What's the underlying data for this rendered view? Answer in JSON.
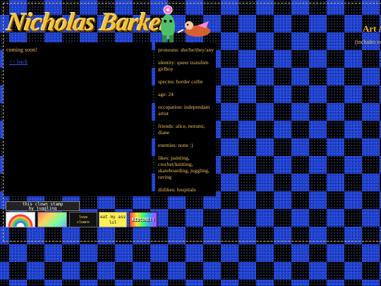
{
  "header": {
    "title": "Nicholas Barker",
    "right_heading": "Art A",
    "right_sub": "(includes ou"
  },
  "left": {
    "coming_soon": "coming soon!",
    "back_link": "<< back"
  },
  "profile": {
    "pronouns": "pronouns: she/he/they/any",
    "identity": "identity: queer transfem girlboy",
    "species": "species: border collie",
    "age": "age: 24",
    "occupation": "occupation: independant artist",
    "friends": "friends: alice, nezumi, diane",
    "enemies": "enemies: none :)",
    "likes": "likes: painting, crochet/knitting, skateboarding, juggling, raving",
    "dislikes": "dislikes: hospitals"
  },
  "badges": {
    "clown_stamp": "this clown stamp\nby juggling",
    "eat_my_ass": "eat my ass\nlol",
    "kidcore": "KIDCORE!!",
    "small4": "love\nclowns"
  },
  "colors": {
    "accent_gold": "#f0c060",
    "link_blue": "#2f5de0",
    "checker_blue": "#1e40d0"
  }
}
